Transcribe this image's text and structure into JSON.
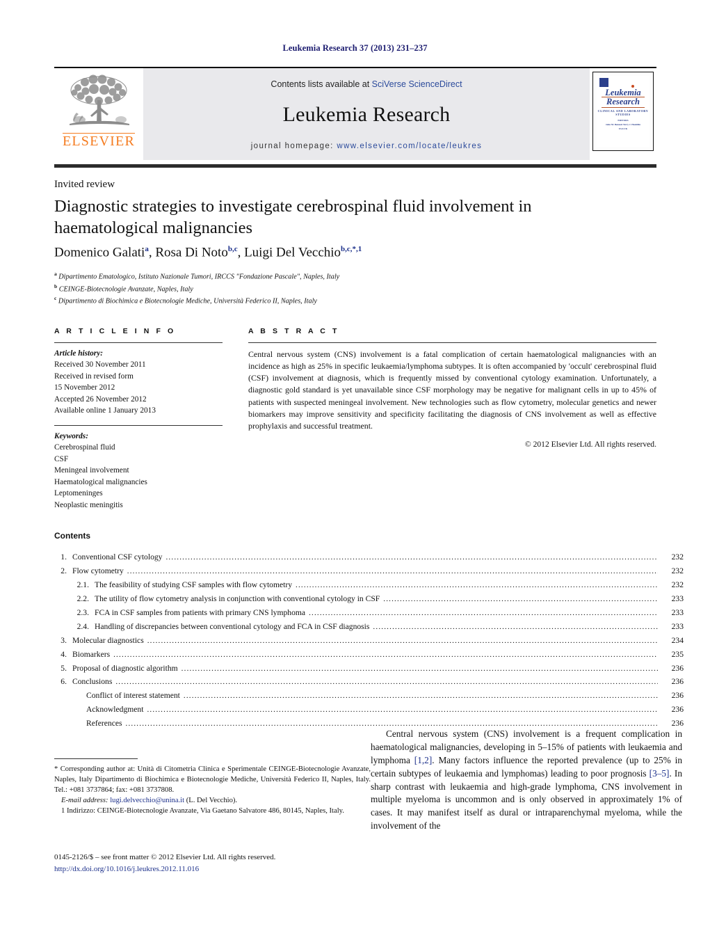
{
  "running_head": "Leukemia Research 37 (2013) 231–237",
  "masthead": {
    "publisher_logo_label": "ELSEVIER",
    "contents_prefix": "Contents lists available at ",
    "contents_link": "SciVerse ScienceDirect",
    "journal_title": "Leukemia Research",
    "homepage_prefix": "journal homepage: ",
    "homepage_url": "www.elsevier.com/locate/leukres",
    "cover": {
      "title_line1": "Leukemia",
      "title_line2": "Research",
      "subtitle": "CLINICAL AND LABORATORY STUDIES",
      "editors": "EDITORS\nJohn M. Bennett    Terry J. Hamblin\nUSA                      UK"
    }
  },
  "article": {
    "type": "Invited review",
    "title": "Diagnostic strategies to investigate cerebrospinal fluid involvement in haematological malignancies",
    "authors_html": "Domenico Galati<sup>a</sup>, Rosa Di Noto<sup>b,c</sup>, Luigi Del Vecchio<sup>b,c,*,1</sup>",
    "affiliations": [
      {
        "marker": "a",
        "text": "Dipartimento Ematologico, Istituto Nazionale Tumori, IRCCS \"Fondazione Pascale\", Naples, Italy"
      },
      {
        "marker": "b",
        "text": "CEINGE-Biotecnologie Avanzate, Naples, Italy"
      },
      {
        "marker": "c",
        "text": "Dipartimento di Biochimica e Biotecnologie Mediche, Università Federico II, Naples, Italy"
      }
    ]
  },
  "article_info": {
    "heading": "A R T I C L E    I N F O",
    "history_label": "Article history:",
    "history": [
      "Received 30 November 2011",
      "Received in revised form",
      "15 November 2012",
      "Accepted 26 November 2012",
      "Available online 1 January 2013"
    ],
    "keywords_label": "Keywords:",
    "keywords": [
      "Cerebrospinal fluid",
      "CSF",
      "Meningeal involvement",
      "Haematological malignancies",
      "Leptomeninges",
      "Neoplastic meningitis"
    ]
  },
  "abstract": {
    "heading": "A B S T R A C T",
    "body": "Central nervous system (CNS) involvement is a fatal complication of certain haematological malignancies with an incidence as high as 25% in specific leukaemia/lymphoma subtypes. It is often accompanied by 'occult' cerebrospinal fluid (CSF) involvement at diagnosis, which is frequently missed by conventional cytology examination. Unfortunately, a diagnostic gold standard is yet unavailable since CSF morphology may be negative for malignant cells in up to 45% of patients with suspected meningeal involvement. New technologies such as flow cytometry, molecular genetics and newer biomarkers may improve sensitivity and specificity facilitating the diagnosis of CNS involvement as well as effective prophylaxis and successful treatment.",
    "copyright": "© 2012 Elsevier Ltd. All rights reserved."
  },
  "contents": {
    "heading": "Contents",
    "entries": [
      {
        "num": "1.",
        "level": 0,
        "label": "Conventional CSF cytology",
        "page": "232"
      },
      {
        "num": "2.",
        "level": 0,
        "label": "Flow cytometry",
        "page": "232"
      },
      {
        "num": "2.1.",
        "level": 1,
        "label": "The feasibility of studying CSF samples with flow cytometry",
        "page": "232"
      },
      {
        "num": "2.2.",
        "level": 1,
        "label": "The utility of flow cytometry analysis in conjunction with conventional cytology in CSF",
        "page": "233"
      },
      {
        "num": "2.3.",
        "level": 1,
        "label": "FCA in CSF samples from patients with primary CNS lymphoma",
        "page": "233"
      },
      {
        "num": "2.4.",
        "level": 1,
        "label": "Handling of discrepancies between conventional cytology and FCA in CSF diagnosis",
        "page": "233"
      },
      {
        "num": "3.",
        "level": 0,
        "label": "Molecular diagnostics",
        "page": "234"
      },
      {
        "num": "4.",
        "level": 0,
        "label": "Biomarkers",
        "page": "235"
      },
      {
        "num": "5.",
        "level": 0,
        "label": "Proposal of diagnostic algorithm",
        "page": "236"
      },
      {
        "num": "6.",
        "level": 0,
        "label": "Conclusions",
        "page": "236"
      },
      {
        "num": "",
        "level": 2,
        "label": "Conflict of interest statement",
        "page": "236"
      },
      {
        "num": "",
        "level": 2,
        "label": "Acknowledgment",
        "page": "236"
      },
      {
        "num": "",
        "level": 2,
        "label": "References",
        "page": "236"
      }
    ]
  },
  "footnotes": {
    "corresponding": "* Corresponding author at: Unità di Citometria Clinica e Sperimentale CEINGE-Biotecnologie Avanzate, Naples, Italy Dipartimento di Biochimica e Biotecnologie Mediche, Università Federico II, Naples, Italy. Tel.: +081 3737864; fax: +081 3737808.",
    "email_label": "E-mail address:",
    "email": "lugi.delvecchio@unina.it",
    "email_owner": "(L. Del Vecchio).",
    "address_note": "1 Indirizzo: CEINGE-Biotecnologie Avanzate, Via Gaetano Salvatore 486, 80145, Naples, Italy."
  },
  "intro": {
    "part1": "Central nervous system (CNS) involvement is a frequent complication in haematological malignancies, developing in 5–15% of patients with leukaemia and lymphoma ",
    "ref1": "[1,2]",
    "part2": ". Many factors influence the reported prevalence (up to 25% in certain subtypes of leukaemia and lymphomas) leading to poor prognosis ",
    "ref2": "[3–5]",
    "part3": ". In sharp contrast with leukaemia and high-grade lymphoma, CNS involvement in multiple myeloma is uncommon and is only observed in approximately 1% of cases. It may manifest itself as dural or intraparenchymal myeloma, while the involvement of the"
  },
  "footer": {
    "issn_line": "0145-2126/$ – see front matter © 2012 Elsevier Ltd. All rights reserved.",
    "doi": "http://dx.doi.org/10.1016/j.leukres.2012.11.016"
  }
}
